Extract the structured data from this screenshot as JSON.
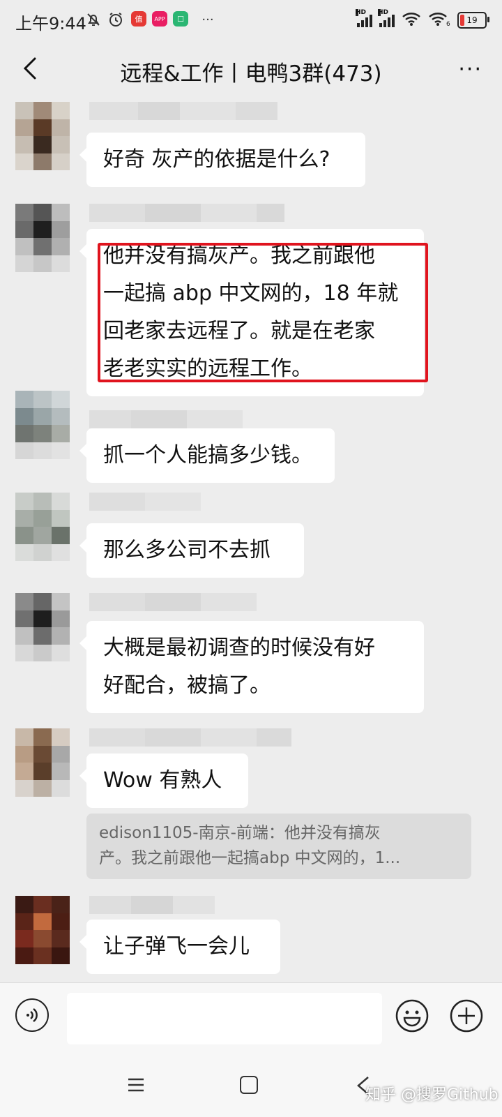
{
  "status_bar": {
    "time": "上午9:44",
    "battery": "19",
    "more": "···",
    "hd_label": "HD",
    "app_badges": [
      "值",
      "APP",
      "☐"
    ]
  },
  "header": {
    "title": "远程&工作丨电鸭3群(473)",
    "more_label": "···"
  },
  "messages": [
    {
      "lines": [
        "好奇 灰产的依据是什么?"
      ]
    },
    {
      "lines": [
        "他并没有搞灰产。我之前跟他",
        "一起搞 abp 中文网的，18 年就",
        "回老家去远程了。就是在老家",
        "老老实实的远程工作。"
      ],
      "highlighted": true
    },
    {
      "lines": [
        "抓一个人能搞多少钱。"
      ]
    },
    {
      "lines": [
        "那么多公司不去抓"
      ]
    },
    {
      "lines": [
        "大概是最初调查的时候没有好",
        "好配合，被搞了。"
      ]
    },
    {
      "lines": [
        "Wow 有熟人"
      ]
    },
    {
      "lines": [
        "让子弹飞一会儿"
      ]
    }
  ],
  "quote": {
    "lines": [
      "edison1105-南京-前端：他并没有搞灰",
      "产。我之前跟他一起搞abp 中文网的，1..."
    ]
  },
  "input_bar": {
    "value": "",
    "icons": [
      "voice-icon",
      "emoji-icon",
      "plus-icon"
    ]
  },
  "nav_bar": {
    "icons": [
      "menu-icon",
      "home-icon",
      "back-icon"
    ]
  },
  "watermark": "知乎 @搜罗Github",
  "colors": {
    "background": "#ededed",
    "bubble": "#ffffff",
    "highlight_box": "#e0141e",
    "quote_bg": "#dcdcdc"
  }
}
